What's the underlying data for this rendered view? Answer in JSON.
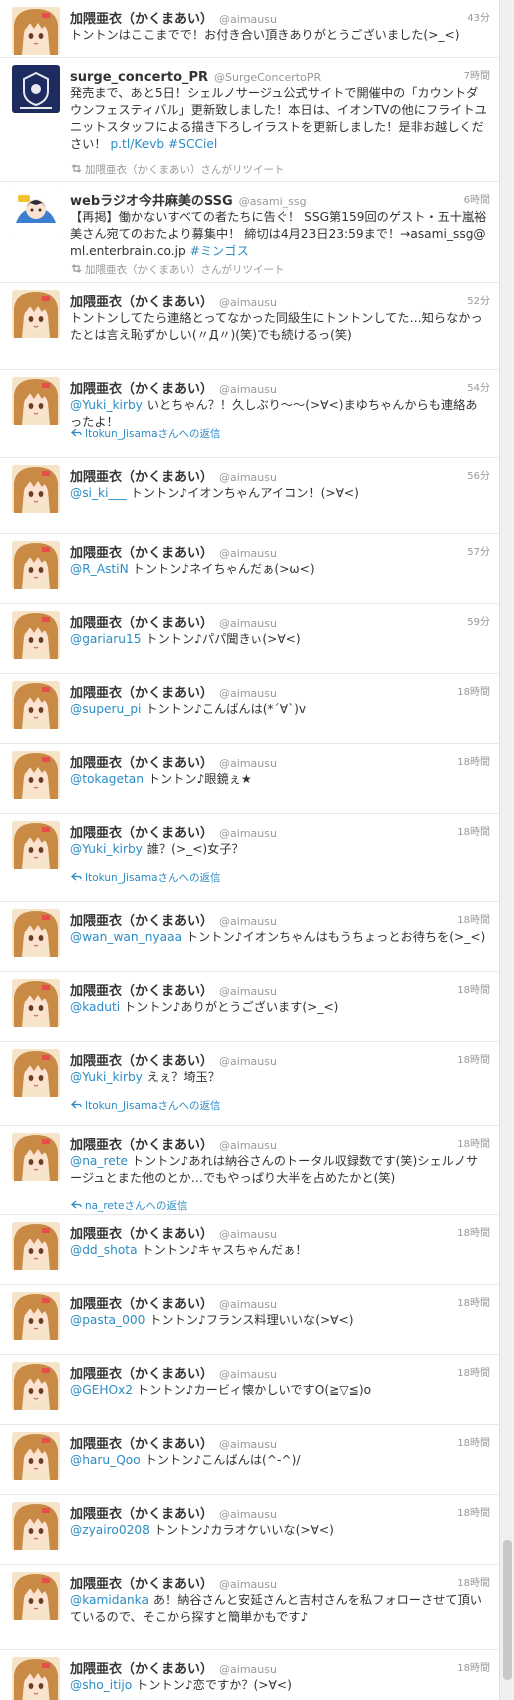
{
  "tweets": [
    {
      "name": "加隈亜衣（かくまあい）",
      "handle": "@aimausu",
      "time": "43分",
      "avatar": "anime-girl-avatar",
      "segments": [
        {
          "t": "トントンはここまでで！お付き合い頂きありがとうございました(>_<)",
          "k": "text"
        }
      ]
    },
    {
      "name": "surge_concerto_PR",
      "handle": "@SurgeConcertoPR",
      "time": "7時間",
      "avatar": "surge-concerto-logo",
      "segments": [
        {
          "t": "発売まで、あと5日！シェルノサージュ公式サイトで開催中の「カウントダウンフェスティバル」更新致しました！本日は、イオンTVの他にフライトユニットスタッフによる描き下ろしイラストを更新しました！是非お越しください！ ",
          "k": "text"
        },
        {
          "t": "p.tl/Kevb",
          "k": "link"
        },
        {
          "t": " ",
          "k": "text"
        },
        {
          "t": "#SCCiel",
          "k": "hashtag"
        }
      ],
      "sub": "加隈亜衣（かくまあい）さんがリツイート",
      "sub_type": "retweet"
    },
    {
      "name": "webラジオ今井麻美のSSG",
      "handle": "@asami_ssg",
      "time": "6時間",
      "avatar": "ssg-radio-avatar",
      "segments": [
        {
          "t": "【再掲】働かないすべての者たちに告ぐ！ SSG第159回のゲスト・五十嵐裕美さん宛てのおたより募集中！ 締切は4月23日23:59まで！→asami_ssg@ml.enterbrain.co.jp ",
          "k": "text"
        },
        {
          "t": "#ミンゴス",
          "k": "hashtag"
        }
      ],
      "sub": "加隈亜衣（かくまあい）さんがリツイート",
      "sub_type": "retweet"
    },
    {
      "name": "加隈亜衣（かくまあい）",
      "handle": "@aimausu",
      "time": "52分",
      "avatar": "anime-girl-avatar",
      "segments": [
        {
          "t": "トントンしてたら連絡とってなかった同級生にトントンしてた…知らなかったとは言え恥ずかしい(〃Д〃)(笑)でも続けるっ(笑)",
          "k": "text"
        }
      ]
    },
    {
      "name": "加隈亜衣（かくまあい）",
      "handle": "@aimausu",
      "time": "54分",
      "avatar": "anime-girl-avatar",
      "segments": [
        {
          "t": "@Yuki_kirby",
          "k": "mention"
        },
        {
          "t": " いとちゃん？！久しぶり〜〜(>∀<)まゆちゃんからも連絡あったよ！",
          "k": "text"
        }
      ],
      "sub": "Itokun_Jisamaさんへの返信",
      "sub_type": "reply"
    },
    {
      "name": "加隈亜衣（かくまあい）",
      "handle": "@aimausu",
      "time": "56分",
      "avatar": "anime-girl-avatar",
      "segments": [
        {
          "t": "@si_ki___",
          "k": "mention"
        },
        {
          "t": " トントン♪イオンちゃんアイコン！(>∀<)",
          "k": "text"
        }
      ]
    },
    {
      "name": "加隈亜衣（かくまあい）",
      "handle": "@aimausu",
      "time": "57分",
      "avatar": "anime-girl-avatar",
      "segments": [
        {
          "t": "@R_AstiN",
          "k": "mention"
        },
        {
          "t": " トントン♪ネイちゃんだぁ(>ω<)",
          "k": "text"
        }
      ]
    },
    {
      "name": "加隈亜衣（かくまあい）",
      "handle": "@aimausu",
      "time": "59分",
      "avatar": "anime-girl-avatar",
      "segments": [
        {
          "t": "@gariaru15",
          "k": "mention"
        },
        {
          "t": " トントン♪パパ聞きぃ(>∀<)",
          "k": "text"
        }
      ]
    },
    {
      "name": "加隈亜衣（かくまあい）",
      "handle": "@aimausu",
      "time": "18時間",
      "avatar": "anime-girl-avatar",
      "segments": [
        {
          "t": "@superu_pi",
          "k": "mention"
        },
        {
          "t": " トントン♪こんばんは(*´∀`)v",
          "k": "text"
        }
      ]
    },
    {
      "name": "加隈亜衣（かくまあい）",
      "handle": "@aimausu",
      "time": "18時間",
      "avatar": "anime-girl-avatar",
      "segments": [
        {
          "t": "@tokagetan",
          "k": "mention"
        },
        {
          "t": " トントン♪眼鏡ぇ★",
          "k": "text"
        }
      ]
    },
    {
      "name": "加隈亜衣（かくまあい）",
      "handle": "@aimausu",
      "time": "18時間",
      "avatar": "anime-girl-avatar",
      "segments": [
        {
          "t": "@Yuki_kirby",
          "k": "mention"
        },
        {
          "t": " 誰？(>_<)女子？",
          "k": "text"
        }
      ],
      "sub": "Itokun_Jisamaさんへの返信",
      "sub_type": "reply"
    },
    {
      "name": "加隈亜衣（かくまあい）",
      "handle": "@aimausu",
      "time": "18時間",
      "avatar": "anime-girl-avatar",
      "segments": [
        {
          "t": "@wan_wan_nyaaa",
          "k": "mention"
        },
        {
          "t": " トントン♪イオンちゃんはもうちょっとお待ちを(>_<)",
          "k": "text"
        }
      ]
    },
    {
      "name": "加隈亜衣（かくまあい）",
      "handle": "@aimausu",
      "time": "18時間",
      "avatar": "anime-girl-avatar",
      "segments": [
        {
          "t": "@kaduti",
          "k": "mention"
        },
        {
          "t": " トントン♪ありがとうございます(>_<)",
          "k": "text"
        }
      ]
    },
    {
      "name": "加隈亜衣（かくまあい）",
      "handle": "@aimausu",
      "time": "18時間",
      "avatar": "anime-girl-avatar",
      "segments": [
        {
          "t": "@Yuki_kirby",
          "k": "mention"
        },
        {
          "t": " えぇ？埼玉？",
          "k": "text"
        }
      ],
      "sub": "Itokun_Jisamaさんへの返信",
      "sub_type": "reply"
    },
    {
      "name": "加隈亜衣（かくまあい）",
      "handle": "@aimausu",
      "time": "18時間",
      "avatar": "anime-girl-avatar",
      "segments": [
        {
          "t": "@na_rete",
          "k": "mention"
        },
        {
          "t": " トントン♪あれは納谷さんのトータル収録数です(笑)シェルノサージュとまた他のとか…でもやっぱり大半を占めたかと(笑)",
          "k": "text"
        }
      ],
      "sub": "na_reteさんへの返信",
      "sub_type": "reply"
    },
    {
      "name": "加隈亜衣（かくまあい）",
      "handle": "@aimausu",
      "time": "18時間",
      "avatar": "anime-girl-avatar",
      "segments": [
        {
          "t": "@dd_shota",
          "k": "mention"
        },
        {
          "t": " トントン♪キャスちゃんだぁ！",
          "k": "text"
        }
      ]
    },
    {
      "name": "加隈亜衣（かくまあい）",
      "handle": "@aimausu",
      "time": "18時間",
      "avatar": "anime-girl-avatar",
      "segments": [
        {
          "t": "@pasta_000",
          "k": "mention"
        },
        {
          "t": " トントン♪フランス料理いいな(>∀<)",
          "k": "text"
        }
      ]
    },
    {
      "name": "加隈亜衣（かくまあい）",
      "handle": "@aimausu",
      "time": "18時間",
      "avatar": "anime-girl-avatar",
      "segments": [
        {
          "t": "@GEHOx2",
          "k": "mention"
        },
        {
          "t": " トントン♪カービィ懐かしいですO(≧▽≦)o",
          "k": "text"
        }
      ]
    },
    {
      "name": "加隈亜衣（かくまあい）",
      "handle": "@aimausu",
      "time": "18時間",
      "avatar": "anime-girl-avatar",
      "segments": [
        {
          "t": "@haru_Qoo",
          "k": "mention"
        },
        {
          "t": " トントン♪こんばんは(^-^)/",
          "k": "text"
        }
      ]
    },
    {
      "name": "加隈亜衣（かくまあい）",
      "handle": "@aimausu",
      "time": "18時間",
      "avatar": "anime-girl-avatar",
      "segments": [
        {
          "t": "@zyairo0208",
          "k": "mention"
        },
        {
          "t": " トントン♪カラオケいいな(>∀<)",
          "k": "text"
        }
      ]
    },
    {
      "name": "加隈亜衣（かくまあい）",
      "handle": "@aimausu",
      "time": "18時間",
      "avatar": "anime-girl-avatar",
      "segments": [
        {
          "t": "@kamidanka",
          "k": "mention"
        },
        {
          "t": " あ！納谷さんと安延さんと吉村さんを私フォローさせて頂いているので、そこから探すと簡単かもです♪",
          "k": "text"
        }
      ]
    },
    {
      "name": "加隈亜衣（かくまあい）",
      "handle": "@aimausu",
      "time": "18時間",
      "avatar": "anime-girl-avatar",
      "segments": [
        {
          "t": "@sho_itijo",
          "k": "mention"
        },
        {
          "t": " トントン♪恋ですか？(>∀<)",
          "k": "text"
        }
      ]
    }
  ],
  "icons": {
    "retweet": "retweet-icon",
    "reply": "reply-arrow-icon"
  },
  "colors": {
    "link": "#2b8cc4",
    "meta": "#999999",
    "text": "#333333"
  }
}
